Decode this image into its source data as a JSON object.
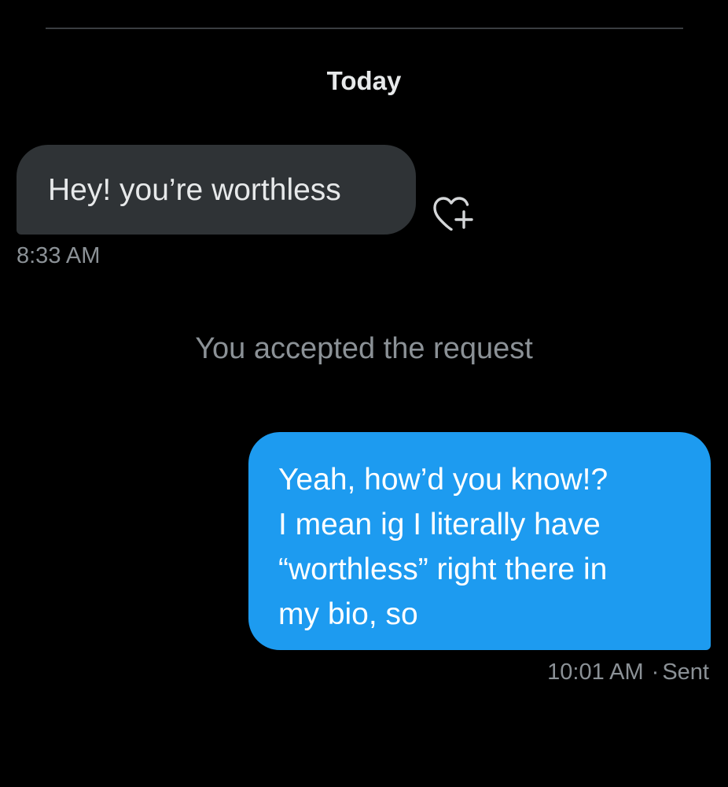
{
  "day_separator": "Today",
  "incoming": {
    "text": "Hey! you’re worthless",
    "time": "8:33 AM",
    "reaction_icon": "heart-plus-icon"
  },
  "system_message": "You accepted the request",
  "outgoing": {
    "lines": [
      "Yeah, how’d you know!?",
      "I mean ig I literally have",
      "“worthless” right there in",
      "my bio, so"
    ],
    "time": "10:01 AM",
    "separator": "·",
    "status": "Sent"
  },
  "colors": {
    "background": "#000000",
    "incoming_bubble": "#2f3336",
    "outgoing_bubble": "#1d9bf0",
    "secondary_text": "#8b9196"
  }
}
